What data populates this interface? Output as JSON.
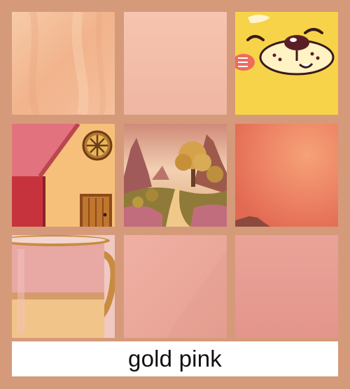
{
  "caption": {
    "text": "gold pink"
  },
  "tiles": [
    {
      "name": "tile-peach-fabric",
      "icon": "fabric-swatch",
      "colors": [
        "#f5c4a0",
        "#e9a57f"
      ]
    },
    {
      "name": "tile-pink-swatch",
      "icon": "solid-swatch",
      "colors": [
        "#f6c4b0",
        "#efb6a2"
      ]
    },
    {
      "name": "tile-yellow-cartoon-cat",
      "icon": "cartoon-cat-face",
      "colors": [
        "#f7d34a",
        "#5a1f24",
        "#ef6b5c"
      ]
    },
    {
      "name": "tile-cottage-illustration",
      "icon": "cottage",
      "colors": [
        "#f1b46b",
        "#e2727e",
        "#c7333c",
        "#b6742d"
      ]
    },
    {
      "name": "tile-fantasy-landscape",
      "icon": "landscape",
      "colors": [
        "#e3a488",
        "#d5a24b",
        "#c26d7e"
      ]
    },
    {
      "name": "tile-sunset-sky",
      "icon": "sunset-sky",
      "colors": [
        "#e9745a",
        "#f0986c"
      ]
    },
    {
      "name": "tile-pink-gold-mug",
      "icon": "mug",
      "colors": [
        "#e8a9a4",
        "#f1c489",
        "#c98b40"
      ]
    },
    {
      "name": "tile-pink-swatch-2",
      "icon": "solid-swatch",
      "colors": [
        "#efb0a3",
        "#e8a095"
      ]
    },
    {
      "name": "tile-rose-swatch",
      "icon": "solid-swatch",
      "colors": [
        "#e9a196",
        "#e3958c"
      ]
    }
  ]
}
